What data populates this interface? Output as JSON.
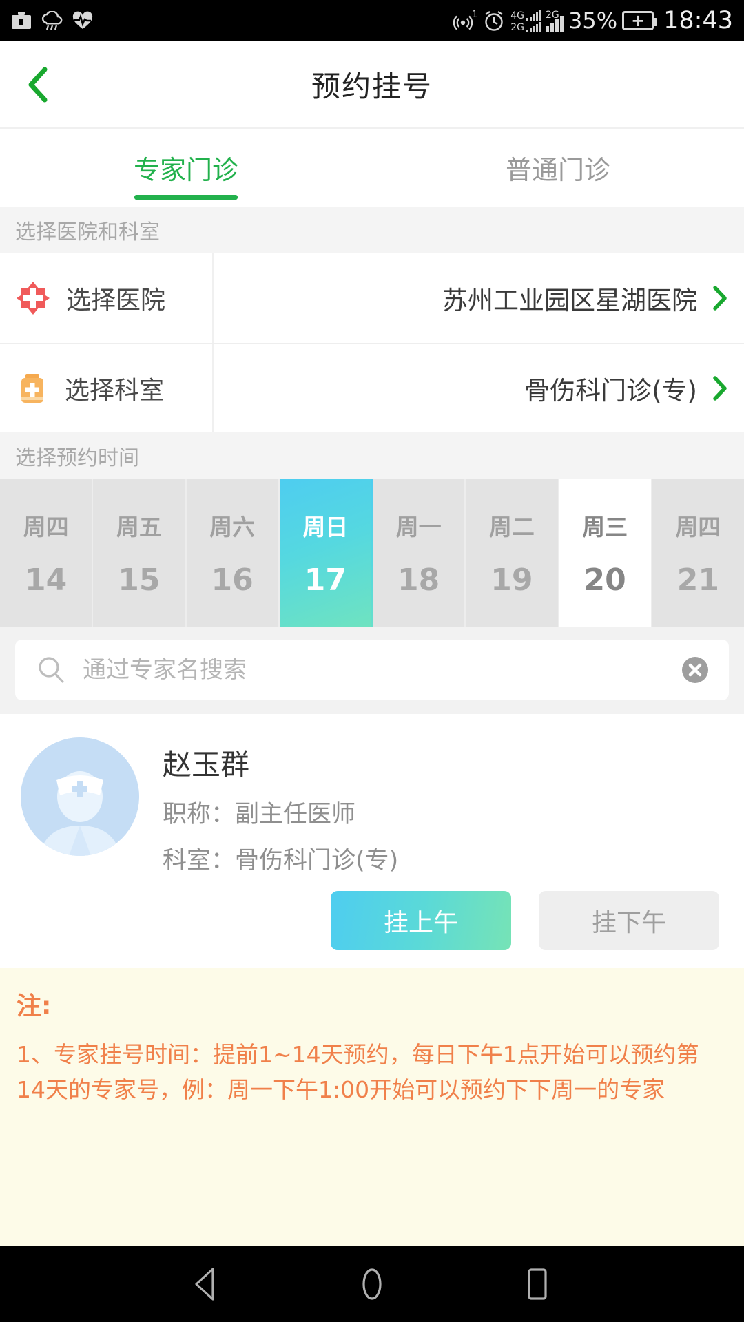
{
  "status_bar": {
    "left_icons": [
      "briefcase-icon",
      "rain-cloud-icon",
      "heartbeat-icon"
    ],
    "hotspot_badge": "1",
    "signal_4g_label": "4G",
    "signal_2g_label": "2G",
    "signal_2g_label2": "2G",
    "battery_percent": "35%",
    "battery_glyph": "+",
    "time": "18:43"
  },
  "header": {
    "title": "预约挂号",
    "back_icon": "chevron-left-icon"
  },
  "tabs": [
    {
      "label": "专家门诊",
      "active": true
    },
    {
      "label": "普通门诊",
      "active": false
    }
  ],
  "hospital_section": {
    "title": "选择医院和科室",
    "rows": [
      {
        "icon": "hospital-cross-icon",
        "label": "选择医院",
        "value": "苏州工业园区星湖医院"
      },
      {
        "icon": "medical-bag-icon",
        "label": "选择科室",
        "value": "骨伤科门诊(专)"
      }
    ]
  },
  "time_section": {
    "title": "选择预约时间",
    "dates": [
      {
        "dow": "周四",
        "day": "14",
        "state": "disabled"
      },
      {
        "dow": "周五",
        "day": "15",
        "state": "disabled"
      },
      {
        "dow": "周六",
        "day": "16",
        "state": "disabled"
      },
      {
        "dow": "周日",
        "day": "17",
        "state": "selected"
      },
      {
        "dow": "周一",
        "day": "18",
        "state": "disabled"
      },
      {
        "dow": "周二",
        "day": "19",
        "state": "disabled"
      },
      {
        "dow": "周三",
        "day": "20",
        "state": "available"
      },
      {
        "dow": "周四",
        "day": "21",
        "state": "disabled"
      }
    ]
  },
  "search": {
    "placeholder": "通过专家名搜索",
    "value": "",
    "search_icon": "search-icon",
    "clear_icon": "clear-circle-icon"
  },
  "doctor": {
    "avatar_icon": "doctor-avatar-icon",
    "name": "赵玉群",
    "title_line": "职称：副主任医师",
    "dept_line": "科室：骨伤科门诊(专)",
    "btn_morning": "挂上午",
    "btn_afternoon": "挂下午",
    "btn_morning_enabled": true,
    "btn_afternoon_enabled": false
  },
  "notes": {
    "title": "注:",
    "body": "1、专家挂号时间：提前1~14天预约，每日下午1点开始可以预约第14天的专家号，例：周一下午1:00开始可以预约下下周一的专家"
  },
  "navbar": {
    "back": "nav-back-icon",
    "home": "nav-home-icon",
    "recents": "nav-recents-icon"
  },
  "colors": {
    "brand_green": "#22b14c",
    "selected_cyan": "#4ecdf0",
    "note_orange": "#f0804a"
  }
}
